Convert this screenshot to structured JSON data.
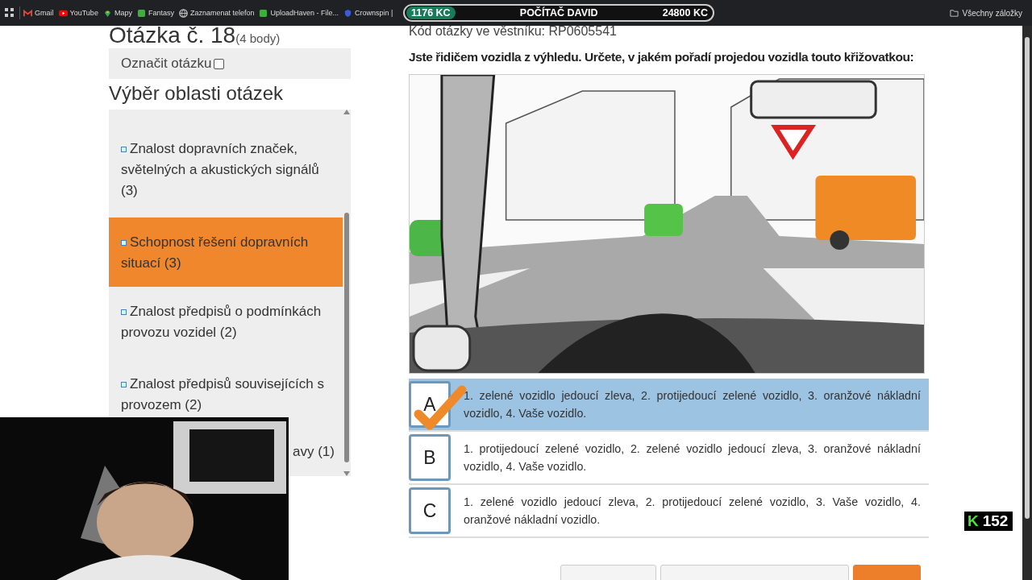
{
  "bookmarks_bar": {
    "items": [
      {
        "label": "Gmail",
        "kind": "mail"
      },
      {
        "label": "YouTube",
        "kind": "video"
      },
      {
        "label": "Mapy",
        "kind": "pin"
      },
      {
        "label": "Fantasy",
        "kind": "square"
      },
      {
        "label": "Zaznamenat telefon",
        "kind": "globe"
      },
      {
        "label": "UploadHaven - File...",
        "kind": "square"
      },
      {
        "label": "Crownspin |",
        "kind": "shield"
      }
    ],
    "all_bookmarks": "Všechny záložky"
  },
  "stream_overlay": {
    "left": "1176 KC",
    "title": "POČÍTAČ DAVID",
    "right": "24800 KC"
  },
  "question": {
    "title": "Otázka č. 18",
    "points": "(4 body)",
    "mark": {
      "label": "Označit otázku",
      "checked": false
    },
    "code": "Kód otázky ve věstníku: RP0605541",
    "text": "Jste řidičem vozidla z výhledu. Určete, v jakém pořadí projedou vozidla touto křižovatkou:"
  },
  "areas": {
    "heading": "Výběr oblasti otázek",
    "items": [
      {
        "label": "Znalost dopravních značek, světelných a akustických signálů (3)",
        "selected": false,
        "bullet": true
      },
      {
        "label": "Schopnost řešení dopravních situací (3)",
        "selected": true,
        "bullet": true
      },
      {
        "label": "Znalost předpisů o podmínkách provozu vozidel (2)",
        "selected": false,
        "bullet": true
      },
      {
        "label": "Znalost předpisů souvisejících s provozem (2)",
        "selected": false,
        "bullet": true
      },
      {
        "label": "avy (1)",
        "selected": false,
        "bullet": false
      }
    ]
  },
  "answers": [
    {
      "letter": "A",
      "text": "1. zelené vozidlo jedoucí zleva, 2. protijedoucí zelené vozidlo, 3. oranžové nákladní vozidlo, 4. Vaše vozidlo.",
      "selected": true
    },
    {
      "letter": "B",
      "text": "1. protijedoucí zelené vozidlo, 2. zelené vozidlo jedoucí zleva, 3. oranžové nákladní vozidlo, 4. Vaše vozidlo.",
      "selected": false
    },
    {
      "letter": "C",
      "text": "1. zelené vozidlo jedoucí zleva, 2. protijedoucí zelené vozidlo, 3. Vaše vozidlo, 4. oranžové nákladní vozidlo.",
      "selected": false
    }
  ],
  "footer_buttons": [
    {
      "kind": "secondary"
    },
    {
      "kind": "secondary"
    },
    {
      "kind": "primary"
    }
  ],
  "counter_badge": {
    "letter": "K",
    "value": "152"
  }
}
